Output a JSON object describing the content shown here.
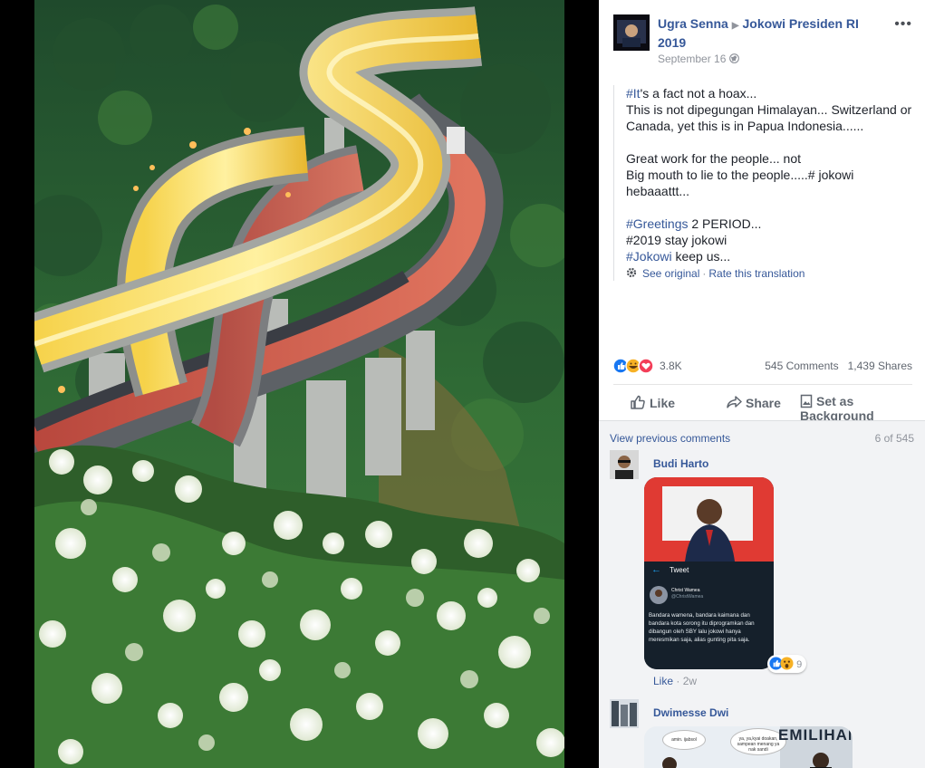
{
  "post": {
    "author": "Ugra Senna",
    "group": "Jokowi Presiden RI 2019",
    "date": "September 16",
    "avatar_text_top": "No",
    "avatar_text_bottom": "JOKOWI"
  },
  "translation": {
    "lines": [
      [
        "#It",
        "'s a fact not a hoax..."
      ],
      [
        "",
        "This is not dipegungan Himalayan... Switzerland or Canada, yet this is in Papua Indonesia......"
      ],
      [
        "",
        ""
      ],
      [
        "",
        "Great work for the people... not"
      ],
      [
        "",
        "Big mouth to lie to the people.....# jokowi hebaaattt..."
      ],
      [
        "",
        ""
      ],
      [
        "#Greetings",
        " 2 PERIOD..."
      ],
      [
        "",
        "#2019 stay jokowi"
      ],
      [
        "#Jokowi",
        " keep us..."
      ]
    ],
    "see_original": "See original",
    "separator": "·",
    "rate_translation": "Rate this translation"
  },
  "stats": {
    "reactions": "3.8K",
    "comments": "545 Comments",
    "shares": "1,439 Shares"
  },
  "actions": {
    "like": "Like",
    "share": "Share",
    "background": "Set as Background"
  },
  "comments_section": {
    "view_previous": "View previous comments",
    "count": "6 of 545",
    "items": [
      {
        "name": "Budi Harto",
        "tweet_header": "Tweet",
        "tweet_name": "Christ Wamea",
        "tweet_handle": "@ChristWamea",
        "tweet_text": "Bandara wamena, bandara kaimana dan bandara kota sorong itu diprogramkan dan dibangun oleh SBY lalu jokowi hanya meresmikan saja, alias gunting pita saja.",
        "reaction_count": "9",
        "like": "Like",
        "time": "2w"
      },
      {
        "name": "Dwimesse Dwi",
        "bubble1": "amin. ijabsol",
        "bubble2": "ya, ya,kyai doakan, sampean menang ya nak sandi",
        "banner": "EMILIHAN"
      }
    ]
  },
  "colors": {
    "link": "#365899",
    "muted": "#90949c",
    "text": "#1d2129",
    "like_blue": "#1877f2",
    "love_red": "#f33e58",
    "haha_yellow": "#f7b125"
  }
}
